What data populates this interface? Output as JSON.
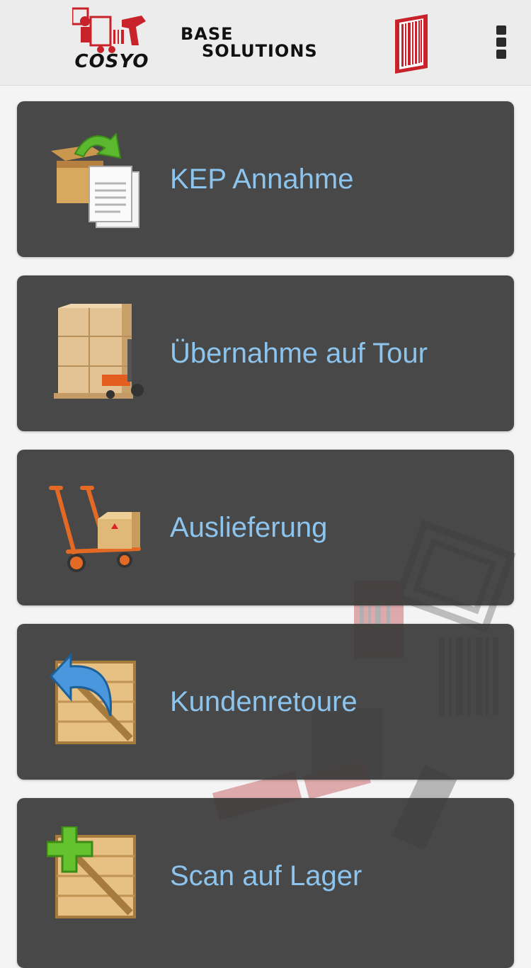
{
  "header": {
    "cosyo_logo_text": "COSYO",
    "base_line1": "BASE",
    "base_line2": "SOLUTIONS"
  },
  "menu": [
    {
      "label": "KEP Annahme",
      "icon": "box-document-icon"
    },
    {
      "label": "Übernahme auf Tour",
      "icon": "pallet-truck-icon"
    },
    {
      "label": "Auslieferung",
      "icon": "hand-truck-icon"
    },
    {
      "label": "Kundenretoure",
      "icon": "crate-return-icon"
    },
    {
      "label": "Scan auf Lager",
      "icon": "crate-add-icon"
    }
  ],
  "colors": {
    "tile_bg": "#3a3a3a",
    "label": "#8cc4ee",
    "brand_red": "#c8232a",
    "header_bg": "#ececec"
  }
}
